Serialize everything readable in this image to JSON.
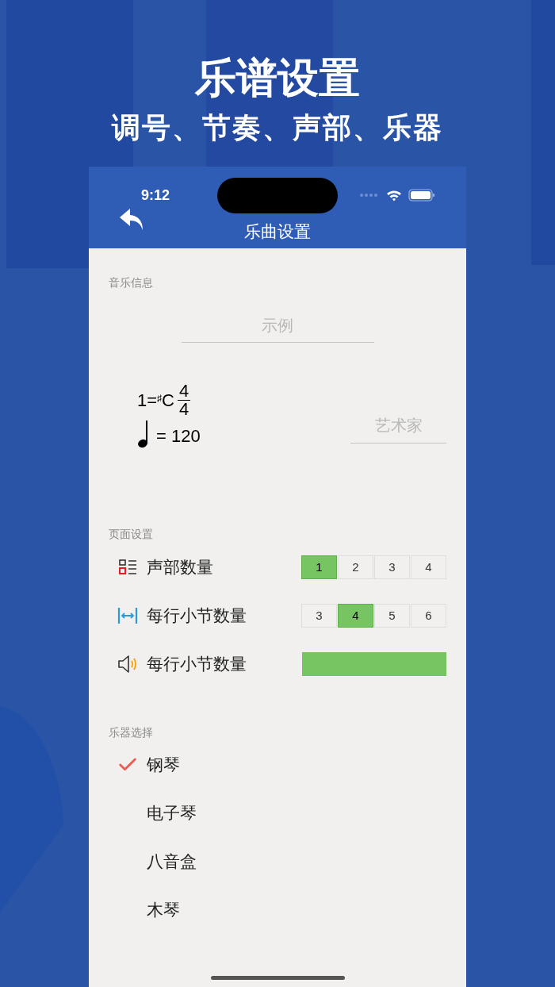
{
  "promo": {
    "title": "乐谱设置",
    "subtitle": "调号、节奏、声部、乐器"
  },
  "status_bar": {
    "time": "9:12"
  },
  "nav": {
    "title": "乐曲设置"
  },
  "music_info": {
    "label": "音乐信息",
    "title_field": {
      "placeholder": "示例"
    },
    "key_signature": {
      "prefix": "1=",
      "accidental": "♯",
      "note": "C"
    },
    "time_signature": {
      "numerator": "4",
      "denominator": "4"
    },
    "tempo": "= 120",
    "artist_field": {
      "placeholder": "艺术家"
    }
  },
  "page_settings": {
    "label": "页面设置",
    "rows": [
      {
        "kind": "segmented",
        "label": "声部数量",
        "options": [
          {
            "label": "1",
            "selected": true
          },
          {
            "label": "2",
            "selected": false
          },
          {
            "label": "3",
            "selected": false
          },
          {
            "label": "4",
            "selected": false
          }
        ]
      },
      {
        "kind": "segmented",
        "label": "每行小节数量",
        "options": [
          {
            "label": "3",
            "selected": false
          },
          {
            "label": "4",
            "selected": true
          },
          {
            "label": "5",
            "selected": false
          },
          {
            "label": "6",
            "selected": false
          }
        ]
      },
      {
        "kind": "bar",
        "label": "每行小节数量",
        "level": 1
      }
    ]
  },
  "instruments": {
    "label": "乐器选择",
    "items": [
      {
        "label": "钢琴",
        "selected": true
      },
      {
        "label": "电子琴",
        "selected": false
      },
      {
        "label": "八音盒",
        "selected": false
      },
      {
        "label": "木琴",
        "selected": false
      }
    ]
  }
}
